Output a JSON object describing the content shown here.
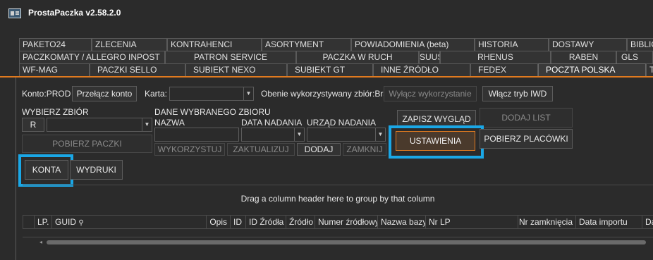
{
  "app": {
    "title": "ProstaPaczka v2.58.2.0"
  },
  "tabs": {
    "row1": [
      "PAKETO24",
      "ZLECENIA",
      "KONTRAHENCI",
      "ASORTYMENT",
      "POWIADOMIENIA (beta)",
      "HISTORIA",
      "DOSTAWY",
      "BIBLIO"
    ],
    "row2": [
      "PACZKOMATY / ALLEGRO INPOST",
      "PATRON SERVICE",
      "PACZKA W RUCH",
      "SUUS",
      "RHENUS",
      "RABEN",
      "GLS"
    ],
    "row3": [
      "WF-MAG",
      "PACZKI SELLO",
      "SUBIEKT NEXO",
      "SUBIEKT GT",
      "INNE ŹRÓDŁO",
      "FEDEX",
      "POCZTA POLSKA",
      "T"
    ]
  },
  "toolbar": {
    "account_label": "Konto:PROD",
    "switch_account": "Przełącz konto",
    "card_label": "Karta:",
    "card_value": "",
    "active_set_label": "Obenie wykorzystywany zbiór:Brak",
    "disable_use": "Wyłącz wykorzystanie",
    "enable_iwd": "Włącz tryb IWD"
  },
  "set": {
    "choose_label": "WYBIERZ ZBIÓR",
    "r_button": "R",
    "fetch_parcels": "POBIERZ PACZKI",
    "data_label": "DANE WYBRANEGO ZBIORU",
    "name_label": "NAZWA",
    "date_label": "DATA NADANIA",
    "office_label": "URZĄD NADANIA",
    "use": "WYKORZYSTUJ",
    "update": "ZAKTUALIZUJ",
    "add": "DODAJ",
    "close": "ZAMKNIJ"
  },
  "actions": {
    "save_view": "ZAPISZ WYGLĄD",
    "add_list": "DODAJ LIST",
    "settings": "USTAWIENIA",
    "fetch_branches": "POBIERZ PLACÓWKI",
    "accounts": "KONTA",
    "printouts": "WYDRUKI"
  },
  "grid": {
    "group_hint": "Drag a column header here to group by that column",
    "columns": [
      "LP.",
      "GUID",
      "Opis",
      "ID",
      "ID Źródła",
      "Źródło",
      "Numer źródłowy",
      "Nazwa bazy",
      "Nr LP",
      "Nr zamknięcia",
      "Data importu",
      "Da"
    ]
  },
  "colors": {
    "accent": "#e07a1f",
    "highlight": "#1aa7e6",
    "background": "#2b2b2b"
  }
}
